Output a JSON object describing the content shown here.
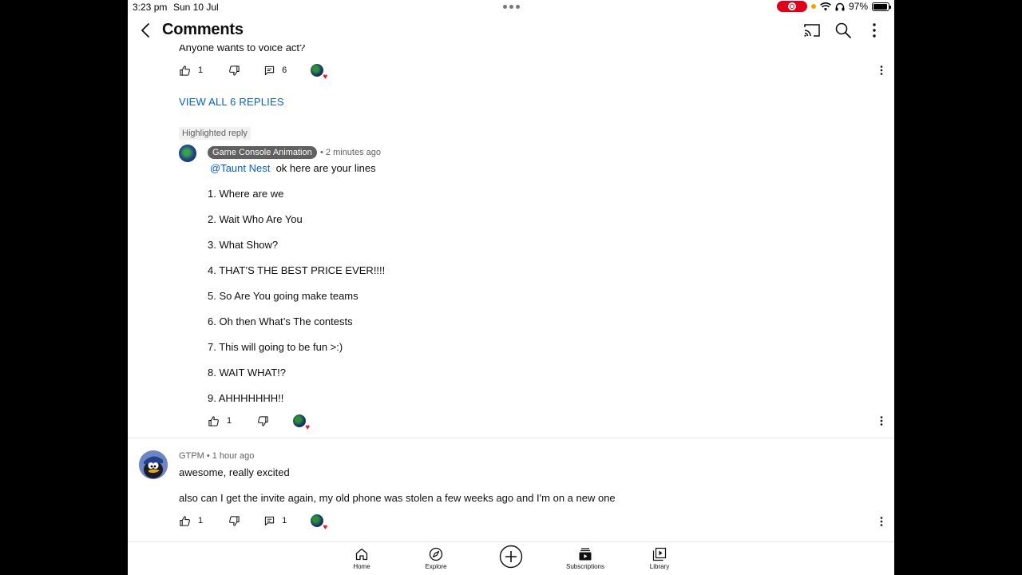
{
  "status": {
    "time": "3:23 pm",
    "date": "Sun 10 Jul",
    "battery": "97%",
    "battery_level": 0.97
  },
  "header": {
    "title": "Comments"
  },
  "top_comment": {
    "text": "Anyone wants to voice act?",
    "likes": "1",
    "replies": "6"
  },
  "view_replies_label": "VIEW ALL 6 REPLIES",
  "highlighted_reply": {
    "badge": "Highlighted reply",
    "author": "Game Console Animation",
    "time": "• 2 minutes ago",
    "mention": "@Taunt Nest",
    "text": "ok here are your lines",
    "lines": [
      "1. Where are we",
      "2. Wait Who Are You",
      "3. What Show?",
      "4. THAT’S THE BEST PRICE EVER!!!!",
      "5. So Are You going make teams",
      "6. Oh then What’s The contests",
      "7. This will going to be fun >:)",
      "8. WAIT WHAT!?",
      "9. AHHHHHHH!!"
    ],
    "likes": "1"
  },
  "gtpm_comment": {
    "author": "GTPM",
    "time": "• 1 hour ago",
    "text1": "awesome, really excited",
    "text2": "also can I get the invite again, my old phone was stolen a few weeks ago and I'm on a new one",
    "likes": "1",
    "replies": "1"
  },
  "nav": {
    "home": "Home",
    "explore": "Explore",
    "subscriptions": "Subscriptions",
    "library": "Library"
  },
  "colors": {
    "link": "#065fd4",
    "record": "#e0001b",
    "heart": "#e01b2f"
  }
}
